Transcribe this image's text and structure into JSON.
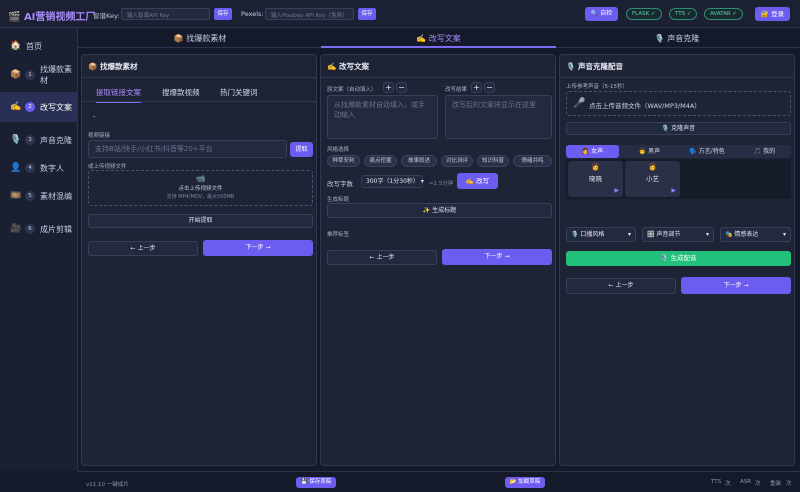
{
  "header": {
    "app_title": "AI营销视频工厂",
    "app_icon": "film-icon",
    "key_label": "智谱Key:",
    "key_placeholder": "输入智谱API Key",
    "save1": "保存",
    "pexels_label": "Pexels:",
    "pexels_placeholder": "输入Pixabay API Key（免费）",
    "save2": "保存",
    "self_check": "自检",
    "status_flask": "FLASK ✓",
    "status_tts": "TTS ✓",
    "status_avatar": "AVATAR ✓",
    "login": "登录"
  },
  "sidebar": {
    "home": "首页",
    "items": [
      {
        "num": "1",
        "label": "找爆款素材",
        "icon": "box-icon"
      },
      {
        "num": "2",
        "label": "改写文案",
        "icon": "pen-icon"
      },
      {
        "num": "3",
        "label": "声音克隆",
        "icon": "mic-icon"
      },
      {
        "num": "4",
        "label": "数字人",
        "icon": "person-icon"
      },
      {
        "num": "5",
        "label": "素材混编",
        "icon": "film-strip-icon"
      },
      {
        "num": "6",
        "label": "成片剪辑",
        "icon": "camera-icon"
      }
    ]
  },
  "tabs": [
    "📦 找爆款素材",
    "✍️ 改写文案",
    "🎙️ 声音克隆"
  ],
  "panel1": {
    "title": "📦 找爆款素材",
    "subtabs": [
      "提取链接文案",
      "搜爆款视频",
      "热门关键词"
    ],
    "dash": "-",
    "link_label": "视频链接",
    "link_placeholder": "支持B站/快手/小红书/抖音等20+平台",
    "extract": "提取",
    "or_upload": "或上传视频文件",
    "upload_text": "点击上传视频文件",
    "upload_hint": "支持 MP4/MOV，最大500MB",
    "start": "开始提取",
    "prev": "← 上一步",
    "next": "下一步 →"
  },
  "panel2": {
    "title": "✍️ 改写文案",
    "orig_label": "原文案（自动填入）",
    "result_label": "改写结果",
    "orig_placeholder": "从找爆款素材自动填入，或手动输入",
    "result_placeholder": "改写后的文案将显示在这里",
    "style_label": "风格选择",
    "styles": [
      "种草安利",
      "痛点挖掘",
      "故事叙述",
      "对比测评",
      "知识科普",
      "情绪共鸣"
    ],
    "wordcount_label": "改写字数",
    "wordcount_value": "300字（1分30秒）",
    "duration": "≈1.5分钟",
    "rewrite": "✍️ 改写",
    "gen_title_label": "生成标题",
    "gen_title_btn": "✨ 生成标题",
    "tags_label": "推荐标签",
    "prev": "← 上一步",
    "next": "下一步 →"
  },
  "panel3": {
    "title": "🎙️ 声音克隆配音",
    "upload_label": "上传参考声音（5-15秒）",
    "upload_text": "点击上传音频文件（WAV/MP3/M4A）",
    "clone_btn": "🎙️ 克隆声音",
    "voice_tabs": [
      "👩 女声",
      "👨 男声",
      "🗣️ 方言/特色",
      "🎵 我的"
    ],
    "voices": [
      {
        "avatar": "👩",
        "name": "晓晓"
      },
      {
        "avatar": "👩",
        "name": "小艺"
      }
    ],
    "sel_style": "🎙️ 口播风格",
    "sel_tone": "🎛️ 声音调节",
    "sel_emotion": "🎭 情感表达",
    "generate": "🎙️ 生成配音",
    "prev": "← 上一步",
    "next": "下一步 →"
  },
  "footer": {
    "version": "v11.10 一键成片",
    "save_draft": "💾 保存草稿",
    "load_draft": "📂 加载草稿",
    "tts_label": "TTS",
    "tts_val": "次",
    "asr_label": "ASR",
    "asr_val": "次",
    "rewrite_label": "重装",
    "rewrite_val": "次"
  },
  "colors": {
    "accent": "#6d5cf0",
    "green": "#22c07a",
    "bg": "#151a2a"
  }
}
